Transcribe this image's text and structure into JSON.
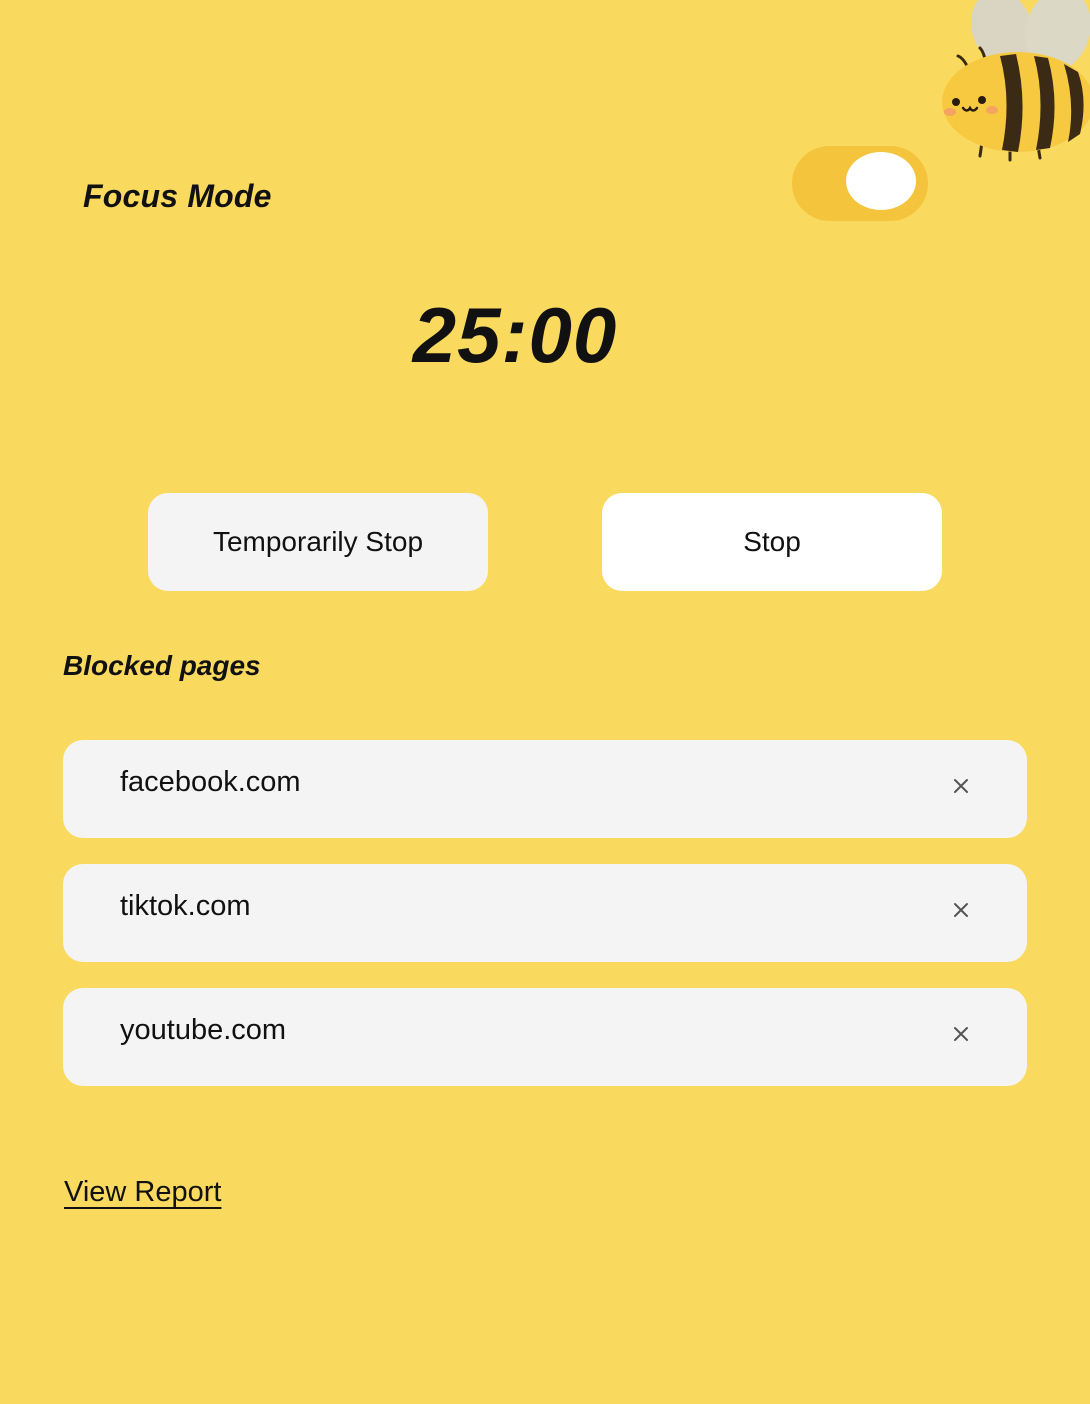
{
  "header": {
    "title": "Focus Mode",
    "toggle_on": true
  },
  "timer": {
    "value": "25:00"
  },
  "actions": {
    "temporarily_stop_label": "Temporarily Stop",
    "stop_label": "Stop"
  },
  "blocked": {
    "heading": "Blocked pages",
    "items": [
      {
        "label": "facebook.com",
        "remove_icon": "close-icon"
      },
      {
        "label": "tiktok.com",
        "remove_icon": "close-icon"
      },
      {
        "label": "youtube.com",
        "remove_icon": "close-icon"
      }
    ]
  },
  "footer": {
    "report_link": "View Report"
  },
  "mascot": {
    "icon": "bee-icon"
  },
  "colors": {
    "background": "#F9D95E",
    "toggle_track": "#F4C43C",
    "button_light": "#F4F4F4",
    "button_white": "#FFFFFF",
    "text": "#111111"
  }
}
